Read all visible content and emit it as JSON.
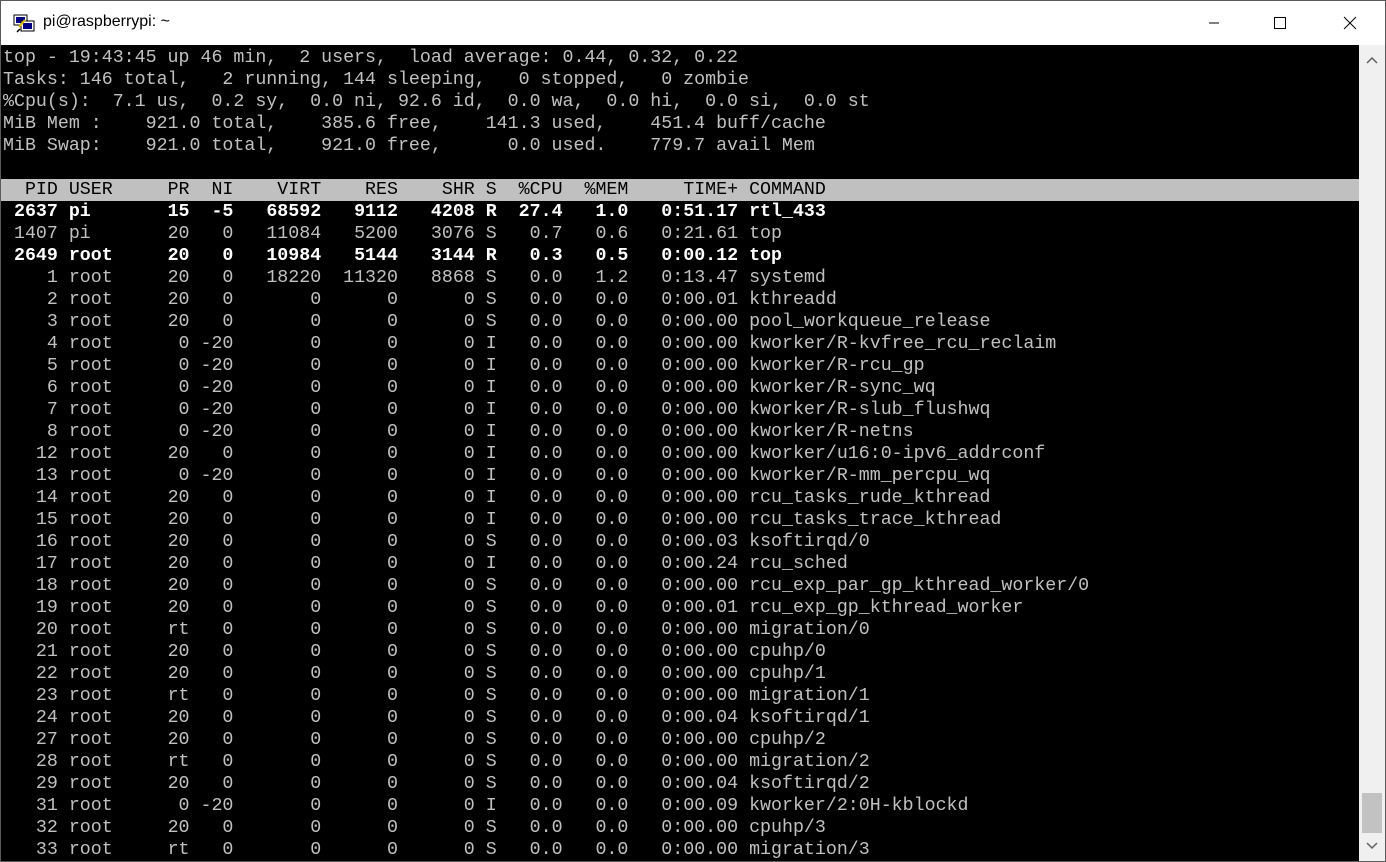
{
  "window": {
    "title": "pi@raspberrypi: ~",
    "icons": {
      "app": "putty-icon",
      "minimize": "minimize-icon",
      "maximize": "maximize-icon",
      "close": "close-icon",
      "scroll_up": "scroll-up-icon",
      "scroll_down": "scroll-down-icon"
    }
  },
  "summary": [
    "top - 19:43:45 up 46 min,  2 users,  load average: 0.44, 0.32, 0.22",
    "Tasks: 146 total,   2 running, 144 sleeping,   0 stopped,   0 zombie",
    "%Cpu(s):  7.1 us,  0.2 sy,  0.0 ni, 92.6 id,  0.0 wa,  0.0 hi,  0.0 si,  0.0 st",
    "MiB Mem :    921.0 total,    385.6 free,    141.3 used,    451.4 buff/cache",
    "MiB Swap:    921.0 total,    921.0 free,      0.0 used.    779.7 avail Mem"
  ],
  "table": {
    "columns": [
      "PID",
      "USER",
      "PR",
      "NI",
      "VIRT",
      "RES",
      "SHR",
      "S",
      "%CPU",
      "%MEM",
      "TIME+",
      "COMMAND"
    ],
    "rows": [
      {
        "pid": "2637",
        "user": "pi",
        "pr": "15",
        "ni": "-5",
        "virt": "68592",
        "res": "9112",
        "shr": "4208",
        "s": "R",
        "cpu": "27.4",
        "mem": "1.0",
        "time": "0:51.17",
        "command": "rtl_433",
        "bold": true
      },
      {
        "pid": "1407",
        "user": "pi",
        "pr": "20",
        "ni": "0",
        "virt": "11084",
        "res": "5200",
        "shr": "3076",
        "s": "S",
        "cpu": "0.7",
        "mem": "0.6",
        "time": "0:21.61",
        "command": "top",
        "bold": false
      },
      {
        "pid": "2649",
        "user": "root",
        "pr": "20",
        "ni": "0",
        "virt": "10984",
        "res": "5144",
        "shr": "3144",
        "s": "R",
        "cpu": "0.3",
        "mem": "0.5",
        "time": "0:00.12",
        "command": "top",
        "bold": true
      },
      {
        "pid": "1",
        "user": "root",
        "pr": "20",
        "ni": "0",
        "virt": "18220",
        "res": "11320",
        "shr": "8868",
        "s": "S",
        "cpu": "0.0",
        "mem": "1.2",
        "time": "0:13.47",
        "command": "systemd",
        "bold": false
      },
      {
        "pid": "2",
        "user": "root",
        "pr": "20",
        "ni": "0",
        "virt": "0",
        "res": "0",
        "shr": "0",
        "s": "S",
        "cpu": "0.0",
        "mem": "0.0",
        "time": "0:00.01",
        "command": "kthreadd",
        "bold": false
      },
      {
        "pid": "3",
        "user": "root",
        "pr": "20",
        "ni": "0",
        "virt": "0",
        "res": "0",
        "shr": "0",
        "s": "S",
        "cpu": "0.0",
        "mem": "0.0",
        "time": "0:00.00",
        "command": "pool_workqueue_release",
        "bold": false
      },
      {
        "pid": "4",
        "user": "root",
        "pr": "0",
        "ni": "-20",
        "virt": "0",
        "res": "0",
        "shr": "0",
        "s": "I",
        "cpu": "0.0",
        "mem": "0.0",
        "time": "0:00.00",
        "command": "kworker/R-kvfree_rcu_reclaim",
        "bold": false
      },
      {
        "pid": "5",
        "user": "root",
        "pr": "0",
        "ni": "-20",
        "virt": "0",
        "res": "0",
        "shr": "0",
        "s": "I",
        "cpu": "0.0",
        "mem": "0.0",
        "time": "0:00.00",
        "command": "kworker/R-rcu_gp",
        "bold": false
      },
      {
        "pid": "6",
        "user": "root",
        "pr": "0",
        "ni": "-20",
        "virt": "0",
        "res": "0",
        "shr": "0",
        "s": "I",
        "cpu": "0.0",
        "mem": "0.0",
        "time": "0:00.00",
        "command": "kworker/R-sync_wq",
        "bold": false
      },
      {
        "pid": "7",
        "user": "root",
        "pr": "0",
        "ni": "-20",
        "virt": "0",
        "res": "0",
        "shr": "0",
        "s": "I",
        "cpu": "0.0",
        "mem": "0.0",
        "time": "0:00.00",
        "command": "kworker/R-slub_flushwq",
        "bold": false
      },
      {
        "pid": "8",
        "user": "root",
        "pr": "0",
        "ni": "-20",
        "virt": "0",
        "res": "0",
        "shr": "0",
        "s": "I",
        "cpu": "0.0",
        "mem": "0.0",
        "time": "0:00.00",
        "command": "kworker/R-netns",
        "bold": false
      },
      {
        "pid": "12",
        "user": "root",
        "pr": "20",
        "ni": "0",
        "virt": "0",
        "res": "0",
        "shr": "0",
        "s": "I",
        "cpu": "0.0",
        "mem": "0.0",
        "time": "0:00.00",
        "command": "kworker/u16:0-ipv6_addrconf",
        "bold": false
      },
      {
        "pid": "13",
        "user": "root",
        "pr": "0",
        "ni": "-20",
        "virt": "0",
        "res": "0",
        "shr": "0",
        "s": "I",
        "cpu": "0.0",
        "mem": "0.0",
        "time": "0:00.00",
        "command": "kworker/R-mm_percpu_wq",
        "bold": false
      },
      {
        "pid": "14",
        "user": "root",
        "pr": "20",
        "ni": "0",
        "virt": "0",
        "res": "0",
        "shr": "0",
        "s": "I",
        "cpu": "0.0",
        "mem": "0.0",
        "time": "0:00.00",
        "command": "rcu_tasks_rude_kthread",
        "bold": false
      },
      {
        "pid": "15",
        "user": "root",
        "pr": "20",
        "ni": "0",
        "virt": "0",
        "res": "0",
        "shr": "0",
        "s": "I",
        "cpu": "0.0",
        "mem": "0.0",
        "time": "0:00.00",
        "command": "rcu_tasks_trace_kthread",
        "bold": false
      },
      {
        "pid": "16",
        "user": "root",
        "pr": "20",
        "ni": "0",
        "virt": "0",
        "res": "0",
        "shr": "0",
        "s": "S",
        "cpu": "0.0",
        "mem": "0.0",
        "time": "0:00.03",
        "command": "ksoftirqd/0",
        "bold": false
      },
      {
        "pid": "17",
        "user": "root",
        "pr": "20",
        "ni": "0",
        "virt": "0",
        "res": "0",
        "shr": "0",
        "s": "I",
        "cpu": "0.0",
        "mem": "0.0",
        "time": "0:00.24",
        "command": "rcu_sched",
        "bold": false
      },
      {
        "pid": "18",
        "user": "root",
        "pr": "20",
        "ni": "0",
        "virt": "0",
        "res": "0",
        "shr": "0",
        "s": "S",
        "cpu": "0.0",
        "mem": "0.0",
        "time": "0:00.00",
        "command": "rcu_exp_par_gp_kthread_worker/0",
        "bold": false
      },
      {
        "pid": "19",
        "user": "root",
        "pr": "20",
        "ni": "0",
        "virt": "0",
        "res": "0",
        "shr": "0",
        "s": "S",
        "cpu": "0.0",
        "mem": "0.0",
        "time": "0:00.01",
        "command": "rcu_exp_gp_kthread_worker",
        "bold": false
      },
      {
        "pid": "20",
        "user": "root",
        "pr": "rt",
        "ni": "0",
        "virt": "0",
        "res": "0",
        "shr": "0",
        "s": "S",
        "cpu": "0.0",
        "mem": "0.0",
        "time": "0:00.00",
        "command": "migration/0",
        "bold": false
      },
      {
        "pid": "21",
        "user": "root",
        "pr": "20",
        "ni": "0",
        "virt": "0",
        "res": "0",
        "shr": "0",
        "s": "S",
        "cpu": "0.0",
        "mem": "0.0",
        "time": "0:00.00",
        "command": "cpuhp/0",
        "bold": false
      },
      {
        "pid": "22",
        "user": "root",
        "pr": "20",
        "ni": "0",
        "virt": "0",
        "res": "0",
        "shr": "0",
        "s": "S",
        "cpu": "0.0",
        "mem": "0.0",
        "time": "0:00.00",
        "command": "cpuhp/1",
        "bold": false
      },
      {
        "pid": "23",
        "user": "root",
        "pr": "rt",
        "ni": "0",
        "virt": "0",
        "res": "0",
        "shr": "0",
        "s": "S",
        "cpu": "0.0",
        "mem": "0.0",
        "time": "0:00.00",
        "command": "migration/1",
        "bold": false
      },
      {
        "pid": "24",
        "user": "root",
        "pr": "20",
        "ni": "0",
        "virt": "0",
        "res": "0",
        "shr": "0",
        "s": "S",
        "cpu": "0.0",
        "mem": "0.0",
        "time": "0:00.04",
        "command": "ksoftirqd/1",
        "bold": false
      },
      {
        "pid": "27",
        "user": "root",
        "pr": "20",
        "ni": "0",
        "virt": "0",
        "res": "0",
        "shr": "0",
        "s": "S",
        "cpu": "0.0",
        "mem": "0.0",
        "time": "0:00.00",
        "command": "cpuhp/2",
        "bold": false
      },
      {
        "pid": "28",
        "user": "root",
        "pr": "rt",
        "ni": "0",
        "virt": "0",
        "res": "0",
        "shr": "0",
        "s": "S",
        "cpu": "0.0",
        "mem": "0.0",
        "time": "0:00.00",
        "command": "migration/2",
        "bold": false
      },
      {
        "pid": "29",
        "user": "root",
        "pr": "20",
        "ni": "0",
        "virt": "0",
        "res": "0",
        "shr": "0",
        "s": "S",
        "cpu": "0.0",
        "mem": "0.0",
        "time": "0:00.04",
        "command": "ksoftirqd/2",
        "bold": false
      },
      {
        "pid": "31",
        "user": "root",
        "pr": "0",
        "ni": "-20",
        "virt": "0",
        "res": "0",
        "shr": "0",
        "s": "I",
        "cpu": "0.0",
        "mem": "0.0",
        "time": "0:00.09",
        "command": "kworker/2:0H-kblockd",
        "bold": false
      },
      {
        "pid": "32",
        "user": "root",
        "pr": "20",
        "ni": "0",
        "virt": "0",
        "res": "0",
        "shr": "0",
        "s": "S",
        "cpu": "0.0",
        "mem": "0.0",
        "time": "0:00.00",
        "command": "cpuhp/3",
        "bold": false
      },
      {
        "pid": "33",
        "user": "root",
        "pr": "rt",
        "ni": "0",
        "virt": "0",
        "res": "0",
        "shr": "0",
        "s": "S",
        "cpu": "0.0",
        "mem": "0.0",
        "time": "0:00.00",
        "command": "migration/3",
        "bold": false
      }
    ]
  },
  "colors": {
    "terminal_bg": "#000000",
    "terminal_fg": "#c0c0c0",
    "bold_fg": "#ffffff",
    "header_bg": "#c0c0c0",
    "header_fg": "#000000"
  }
}
